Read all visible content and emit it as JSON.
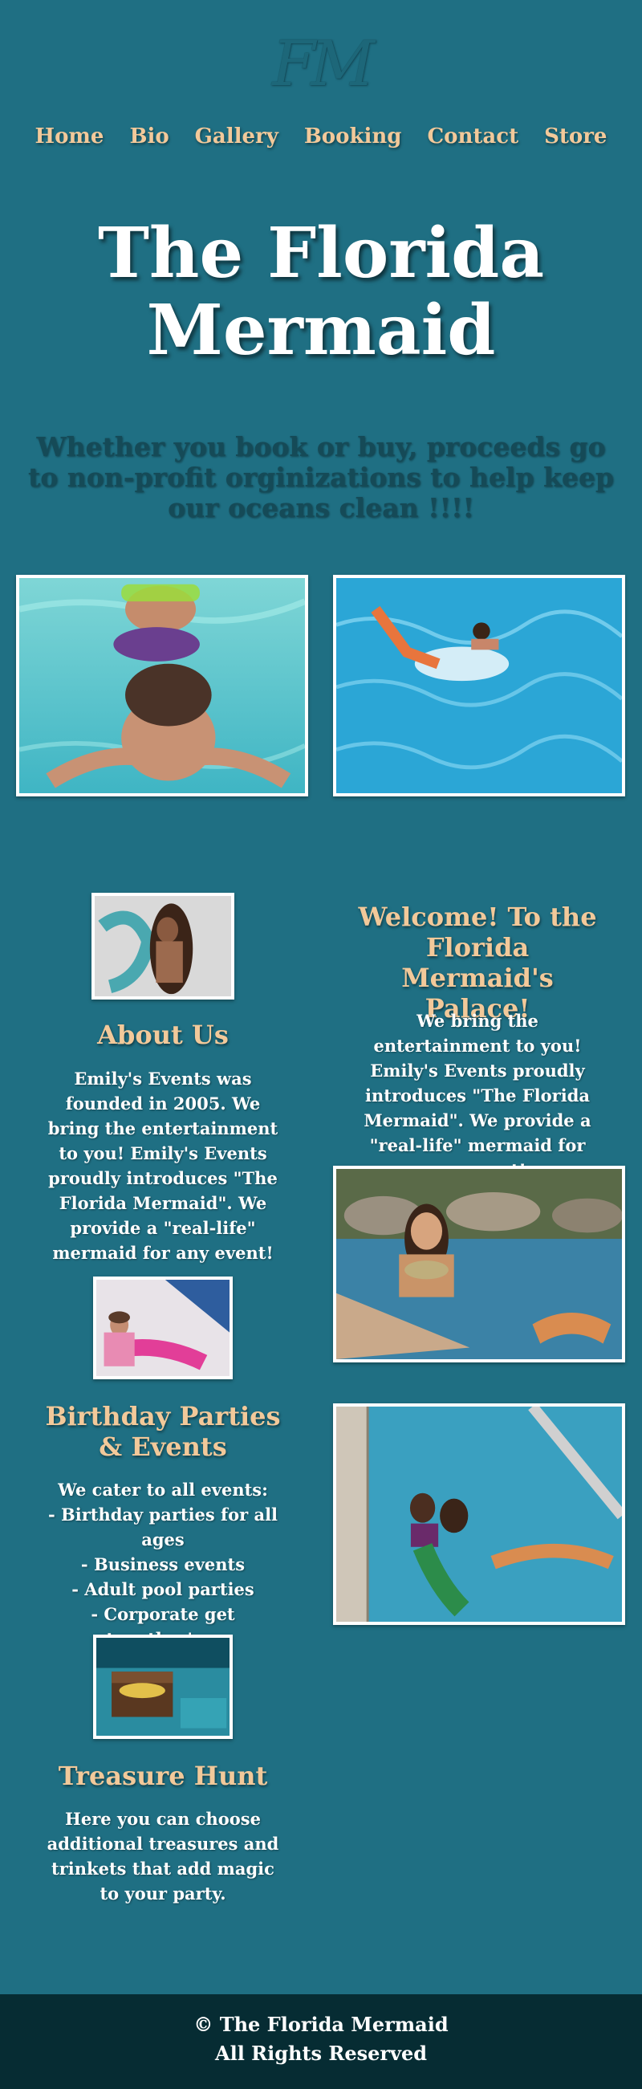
{
  "logo": {
    "text": "FM"
  },
  "nav": {
    "items": [
      {
        "label": "Home"
      },
      {
        "label": "Bio"
      },
      {
        "label": "Gallery"
      },
      {
        "label": "Booking"
      },
      {
        "label": "Contact"
      },
      {
        "label": "Store"
      }
    ]
  },
  "hero": {
    "title": "The Florida Mermaid"
  },
  "tagline": "Whether you book or buy, proceeds go to non-profit orginizations to help keep our oceans clean !!!!",
  "welcome": {
    "title": "Welcome! To the Florida Mermaid's Palace!",
    "text": "We bring the entertainment to you! Emily's Events proudly introduces \"The Florida Mermaid\". We provide a \"real-life\" mermaid for any event!"
  },
  "about": {
    "title": "About Us",
    "text": "Emily's Events was founded in 2005. We bring the entertainment to you! Emily's Events proudly introduces \"The Florida Mermaid\". We provide a \"real-life\" mermaid for any event!"
  },
  "birthday": {
    "title": "Birthday Parties & Events",
    "text": "We cater to all events:\n- Birthday parties for all ages\n- Business events\n- Adult pool parties\n- Corporate get together's..."
  },
  "treasure": {
    "title": "Treasure Hunt",
    "text": "Here you can choose additional treasures and trinkets that add magic to your party."
  },
  "footer": {
    "copyright": "© The Florida Mermaid",
    "rights": "All Rights Reserved"
  },
  "colors": {
    "background": "#1f6f83",
    "accent": "#f2c99a",
    "footer": "#062c33"
  }
}
